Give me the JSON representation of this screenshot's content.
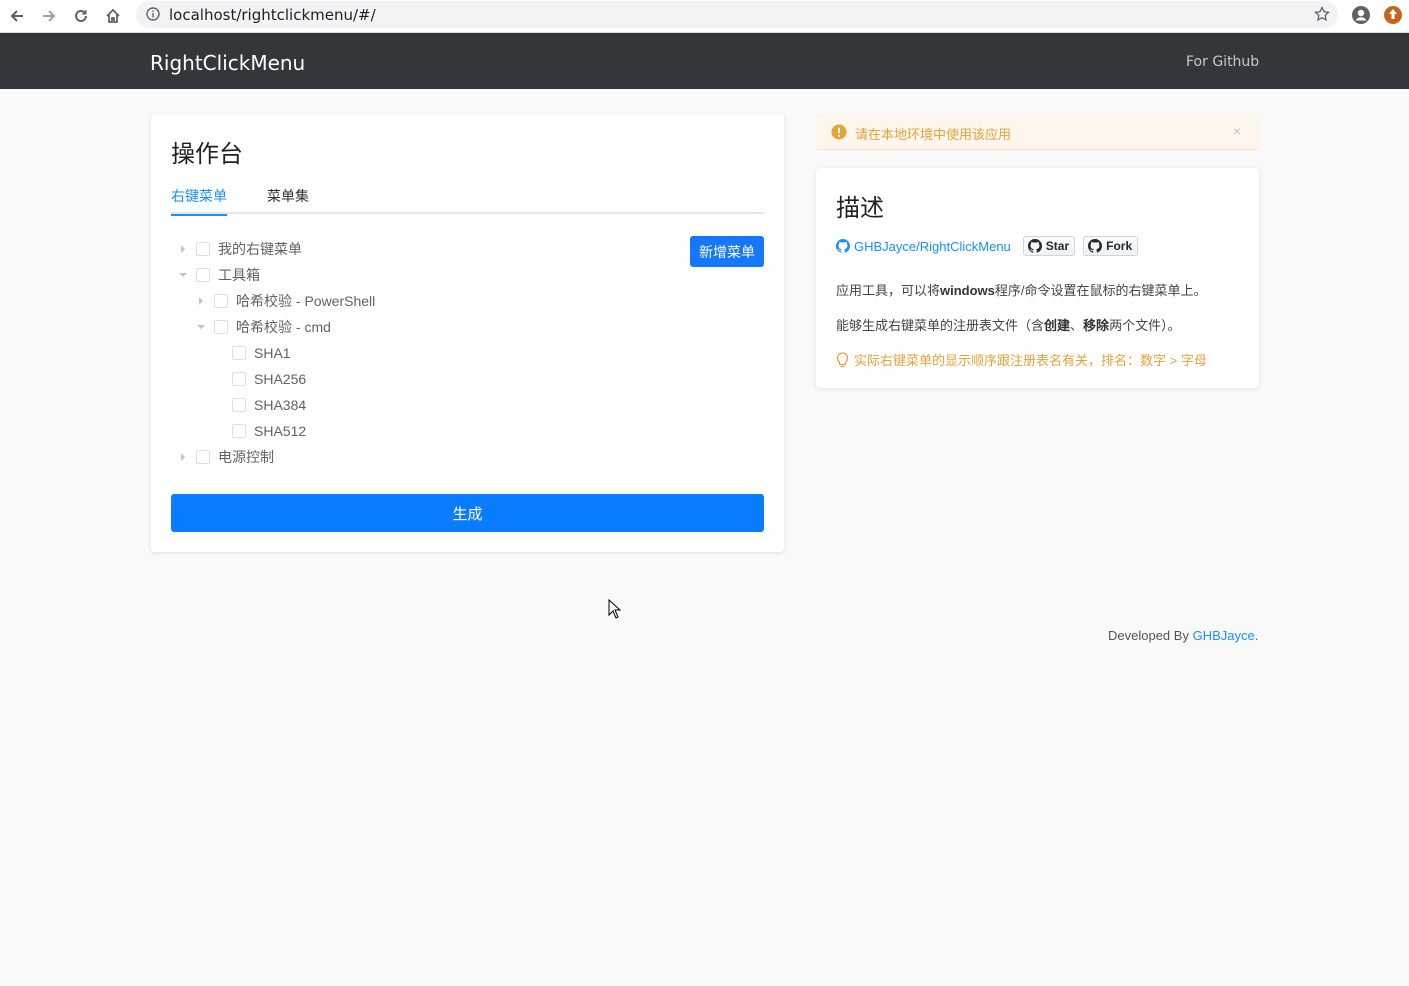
{
  "browser": {
    "url": "localhost/rightclickmenu/#/"
  },
  "navbar": {
    "brand": "RightClickMenu",
    "github_link": "For Github"
  },
  "console": {
    "title": "操作台",
    "tabs": [
      {
        "label": "右键菜单",
        "active": true
      },
      {
        "label": "菜单集",
        "active": false
      }
    ],
    "add_button": "新增菜单",
    "generate_button": "生成",
    "tree": [
      {
        "label": "我的右键菜单",
        "level": 0,
        "expanded": false,
        "has_children": true
      },
      {
        "label": "工具箱",
        "level": 0,
        "expanded": true,
        "has_children": true
      },
      {
        "label": "哈希校验 - PowerShell",
        "level": 1,
        "expanded": false,
        "has_children": true
      },
      {
        "label": "哈希校验 - cmd",
        "level": 1,
        "expanded": true,
        "has_children": true
      },
      {
        "label": "SHA1",
        "level": 2,
        "has_children": false
      },
      {
        "label": "SHA256",
        "level": 2,
        "has_children": false
      },
      {
        "label": "SHA384",
        "level": 2,
        "has_children": false
      },
      {
        "label": "SHA512",
        "level": 2,
        "has_children": false
      },
      {
        "label": "电源控制",
        "level": 0,
        "expanded": false,
        "has_children": true
      }
    ]
  },
  "alert": {
    "text": "请在本地环境中使用该应用",
    "close": "×"
  },
  "description": {
    "title": "描述",
    "repo_link": "GHBJayce/RightClickMenu",
    "star_label": "Star",
    "fork_label": "Fork",
    "line1_a": "应用工具，可以将",
    "line1_b": "windows",
    "line1_c": "程序/命令设置在鼠标的右键菜单上。",
    "line2_a": "能够生成右键菜单的注册表文件（含",
    "line2_b": "创建",
    "line2_c": "、",
    "line2_d": "移除",
    "line2_e": "两个文件）。",
    "tip": "实际右键菜单的显示顺序跟注册表名有关，排名：数字 > 字母"
  },
  "footer": {
    "prefix": "Developed By ",
    "author": "GHBJayce",
    "suffix": "."
  },
  "colors": {
    "navbar_bg": "#33363b",
    "primary": "#0a7cff",
    "link": "#1890ff",
    "warning": "#e6a23c"
  }
}
